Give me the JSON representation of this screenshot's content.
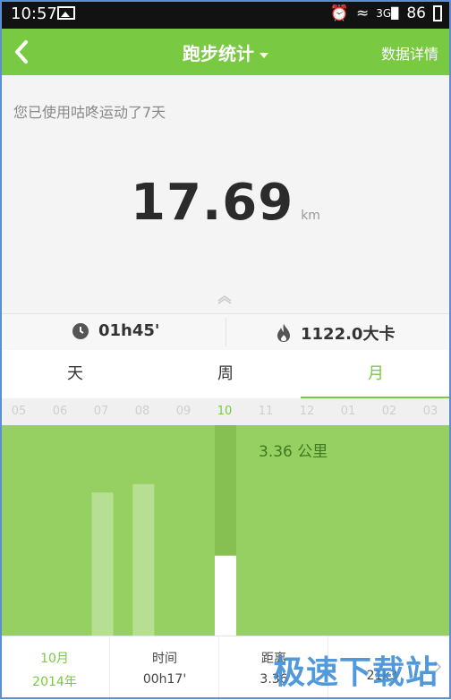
{
  "status_bar": {
    "time": "10:57",
    "battery": "86",
    "network": "3G"
  },
  "header": {
    "title": "跑步统计",
    "detail_label": "数据详情"
  },
  "summary": {
    "usage_text": "您已使用咕咚运动了7天",
    "distance": "17.69",
    "distance_unit": "km"
  },
  "stats": {
    "duration": "01h45'",
    "calories": "1122.0大卡"
  },
  "tabs": [
    {
      "label": "天",
      "active": false
    },
    {
      "label": "周",
      "active": false
    },
    {
      "label": "月",
      "active": true
    }
  ],
  "months": [
    "05",
    "06",
    "07",
    "08",
    "09",
    "10",
    "11",
    "12",
    "01",
    "02",
    "03"
  ],
  "selected_month": "10",
  "chart_data": {
    "type": "bar",
    "categories": [
      "07",
      "08",
      "10"
    ],
    "values": [
      0.68,
      0.72,
      0.38
    ],
    "ylim": [
      0,
      1
    ],
    "selected_label": "3.36 公里",
    "colors": {
      "bar_background": "#96d062",
      "bar_faded": "#b6df93",
      "bar_selected": "#ffffff",
      "selected_column": "#86c052"
    }
  },
  "bottom": {
    "month": "10月",
    "year": "2014年",
    "time_label": "时间",
    "time_value": "00h17'",
    "distance_label": "距离",
    "distance_value": "3.36",
    "col4_value": "21k3"
  },
  "watermark": "极速下载站",
  "colors": {
    "accent": "#7ac943",
    "header_bg": "#7ac943",
    "summary_bg": "#f4f4f4"
  }
}
